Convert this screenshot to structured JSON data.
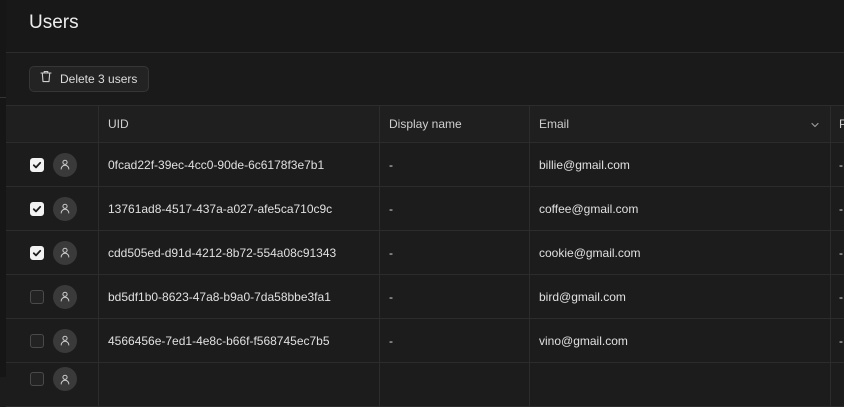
{
  "header": {
    "title": "Users"
  },
  "toolbar": {
    "delete_label": "Delete 3 users",
    "delete_icon": "trash-icon"
  },
  "table": {
    "columns": {
      "uid": "UID",
      "display_name": "Display name",
      "email": "Email",
      "extra": "P"
    },
    "rows": [
      {
        "uid": "0fcad22f-39ec-4cc0-90de-6c6178f3e7b1",
        "display_name": "-",
        "email": "billie@gmail.com",
        "extra": "-",
        "selected": true
      },
      {
        "uid": "13761ad8-4517-437a-a027-afe5ca710c9c",
        "display_name": "-",
        "email": "coffee@gmail.com",
        "extra": "-",
        "selected": true
      },
      {
        "uid": "cdd505ed-d91d-4212-8b72-554a08c91343",
        "display_name": "-",
        "email": "cookie@gmail.com",
        "extra": "-",
        "selected": true
      },
      {
        "uid": "bd5df1b0-8623-47a8-b9a0-7da58bbe3fa1",
        "display_name": "-",
        "email": "bird@gmail.com",
        "extra": "-",
        "selected": false
      },
      {
        "uid": "4566456e-7ed1-4e8c-b66f-f568745ec7b5",
        "display_name": "-",
        "email": "vino@gmail.com",
        "extra": "-",
        "selected": false
      }
    ]
  }
}
